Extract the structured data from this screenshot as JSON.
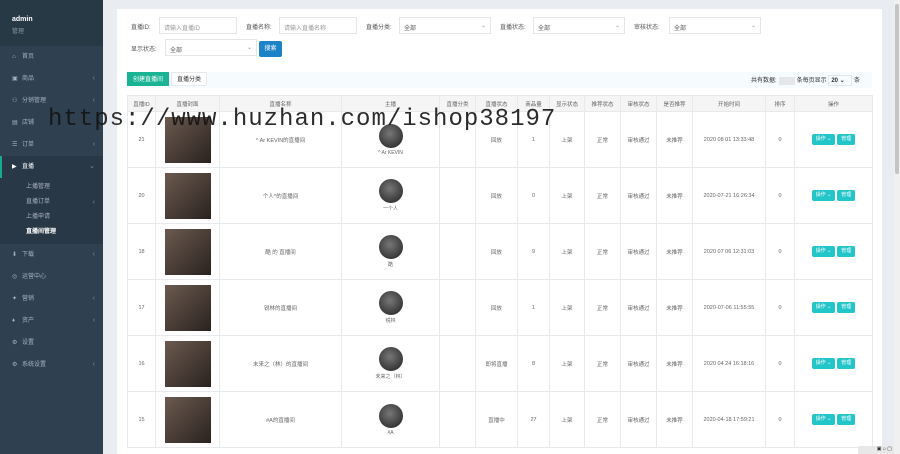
{
  "sidebar": {
    "user": "admin",
    "role": "管理",
    "menu": [
      {
        "label": "首页",
        "icon": "home-icon",
        "glyph": "⌂",
        "has_sub": false
      },
      {
        "label": "商品",
        "icon": "goods-icon",
        "glyph": "▣",
        "has_sub": true
      },
      {
        "label": "分销管理",
        "icon": "distribution-icon",
        "glyph": "⚇",
        "has_sub": true
      },
      {
        "label": "店铺",
        "icon": "shop-icon",
        "glyph": "▤",
        "has_sub": false
      },
      {
        "label": "订单",
        "icon": "order-icon",
        "glyph": "☰",
        "has_sub": true
      },
      {
        "label": "直播",
        "icon": "video-icon",
        "glyph": "▶",
        "has_sub": true,
        "active": true
      }
    ],
    "live_submenu": [
      {
        "label": "上播管理",
        "has_sub": false
      },
      {
        "label": "直播订单",
        "has_sub": true
      },
      {
        "label": "上播申请",
        "has_sub": false
      },
      {
        "label": "直播间管理",
        "has_sub": false,
        "current": true
      }
    ],
    "menu_after": [
      {
        "label": "下载",
        "icon": "download-icon",
        "glyph": "⬇",
        "has_sub": true
      },
      {
        "label": "运营中心",
        "icon": "operation-icon",
        "glyph": "◎",
        "has_sub": false
      },
      {
        "label": "营销",
        "icon": "marketing-icon",
        "glyph": "✦",
        "has_sub": true
      },
      {
        "label": "资产",
        "icon": "asset-icon",
        "glyph": "♦",
        "has_sub": true
      },
      {
        "label": "设置",
        "icon": "settings-icon",
        "glyph": "⚙",
        "has_sub": false
      },
      {
        "label": "系统设置",
        "icon": "system-icon",
        "glyph": "⚙",
        "has_sub": true
      }
    ]
  },
  "filters": {
    "room_id_label": "直播ID:",
    "room_id_placeholder": "请输入直播ID",
    "room_name_label": "直播名称:",
    "room_name_placeholder": "请输入直播名称",
    "category_label": "直播分类:",
    "category_value": "全部",
    "live_status_label": "直播状态:",
    "live_status_value": "全部",
    "audit_status_label": "审核状态:",
    "audit_status_value": "全部",
    "display_status_label": "显示状态:",
    "display_status_value": "全部",
    "search_label": "搜索"
  },
  "toolbar": {
    "create_label": "创建直播间",
    "category_label": "直播分类",
    "total_prefix": "共有数据:",
    "per_page_label": "条每页显示",
    "per_page_value": "20",
    "per_page_suffix": "条"
  },
  "table": {
    "headers": [
      "直播ID",
      "直播封面",
      "直播名称",
      "主播",
      "直播分类",
      "直播状态",
      "商品量",
      "显示状态",
      "推荐状态",
      "审核状态",
      "是否推荐",
      "开始时间",
      "排序",
      "操作"
    ],
    "rows": [
      {
        "id": "21",
        "name": "^ Ar KEVIN的直播间",
        "anchor": "^ Ar KEVIN",
        "category": "",
        "status": "回放",
        "goods": "1",
        "display": "上架",
        "recommend": "正常",
        "audit": "审核通过",
        "featured": "未推荐",
        "start": "2020 08 01 13:33:48",
        "sort": "0"
      },
      {
        "id": "20",
        "name": "个人^的直播间",
        "anchor": "一个人",
        "category": "",
        "status": "回放",
        "goods": "0",
        "display": "上架",
        "recommend": "正常",
        "audit": "审核通过",
        "featured": "未推荐",
        "start": "2020-07-21 16:26:34",
        "sort": "0"
      },
      {
        "id": "18",
        "name": "酷 的 直播间",
        "anchor": "酷",
        "category": "",
        "status": "回放",
        "goods": "9",
        "display": "上架",
        "recommend": "正常",
        "audit": "审核通过",
        "featured": "未推荐",
        "start": "2020 07 06 12:31:03",
        "sort": "0"
      },
      {
        "id": "17",
        "name": "锐林的直播间",
        "anchor": "锐林",
        "category": "",
        "status": "回放",
        "goods": "1",
        "display": "上架",
        "recommend": "正常",
        "audit": "审核通过",
        "featured": "未推荐",
        "start": "2020-07-06 11:55:55",
        "sort": "0"
      },
      {
        "id": "16",
        "name": "未来之（林）的直播间",
        "anchor": "未来之（林）",
        "category": "",
        "status": "即将直播",
        "goods": "8",
        "display": "上架",
        "recommend": "正常",
        "audit": "审核通过",
        "featured": "未推荐",
        "start": "2020 04 24 16:18:16",
        "sort": "0"
      },
      {
        "id": "15",
        "name": "#A的直播间",
        "anchor": "#A",
        "category": "",
        "status": "直播中",
        "goods": "27",
        "display": "上架",
        "recommend": "正常",
        "audit": "审核通过",
        "featured": "未推荐",
        "start": "2020-04-18 17:59:21",
        "sort": "0"
      }
    ],
    "action_label": "操作",
    "edit_label": "管理"
  },
  "watermark": "https://www.huzhan.com/ishop38197",
  "colors": {
    "sidebar": "#2f4050",
    "primary": "#1ab394",
    "info": "#23c6c8",
    "search": "#1c84c6"
  }
}
